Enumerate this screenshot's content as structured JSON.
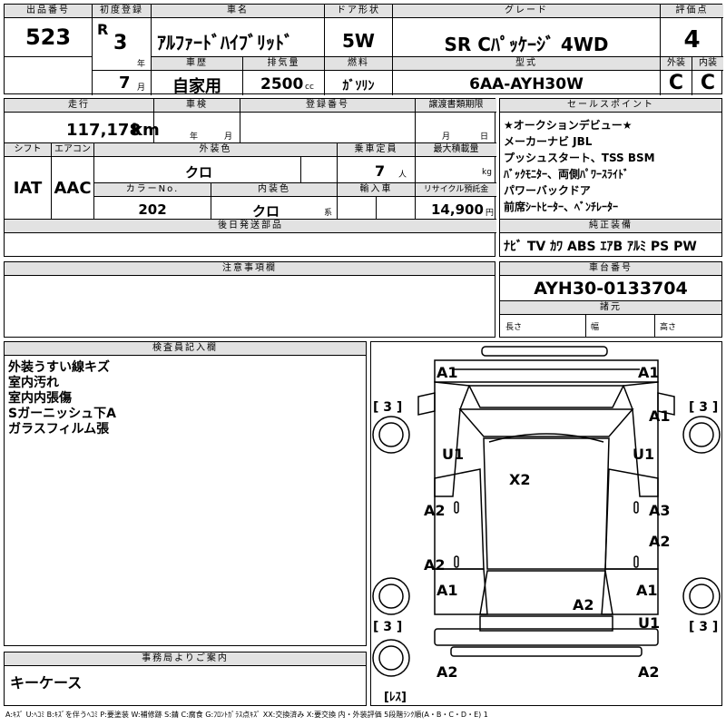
{
  "header": {
    "lot_label": "出品番号",
    "lot": "523",
    "reg_label": "初度登録",
    "era": "R",
    "reg_year": "3",
    "year_unit": "年",
    "reg_month": "7",
    "month_unit": "月",
    "car_name_label": "車名",
    "car_name": "ｱﾙﾌｧｰﾄﾞﾊｲﾌﾞﾘｯﾄﾞ",
    "door_label": "ドア形状",
    "door": "5W",
    "grade_label": "グレード",
    "grade": "SR Cﾊﾟｯｹｰｼﾞ 4WD",
    "score_label": "評価点",
    "score": "4",
    "history_label": "車歴",
    "history": "自家用",
    "disp_label": "排気量",
    "displacement": "2500",
    "disp_unit": "cc",
    "fuel_label": "燃料",
    "fuel": "ｶﾞｿﾘﾝ",
    "model_label": "型式",
    "model": "6AA-AYH30W",
    "ext_label": "外装",
    "ext_grade": "C",
    "int_label": "内装",
    "int_grade": "C"
  },
  "row2": {
    "mileage_label": "走行",
    "mileage": "117,178",
    "mileage_unit": "km",
    "inspection_label": "車検",
    "insp_year": "年",
    "insp_month": "月",
    "regno_label": "登録番号",
    "transfer_label": "譲渡書類期限",
    "tr_month": "月",
    "tr_day": "日",
    "shift_label": "シフト",
    "shift": "IAT",
    "ac_label": "エアコン",
    "ac": "AAC",
    "color_label": "外装色",
    "color": "クロ",
    "capacity_label": "乗車定員",
    "capacity": "7",
    "capacity_unit": "人",
    "load_label": "最大積載量",
    "load_unit": "kg",
    "colorno_label": "カラーNo.",
    "colorno": "202",
    "intcolor_label": "内装色",
    "intcolor": "クロ",
    "intcolor_unit": "系",
    "import_label": "輸入車",
    "recycle_label": "リサイクル預託金",
    "recycle": "14,900",
    "recycle_unit": "円",
    "parts_label": "後日発送部品"
  },
  "selling_points": {
    "label": "セールスポイント",
    "lines": [
      "★オークションデビュー★",
      "メーカーナビ JBL",
      "プッシュスタート、TSS BSM",
      "ﾊﾞｯｸﾓﾆﾀｰ、両側ﾊﾟﾜｰｽﾗｲﾄﾞ",
      "パワーバックドア",
      "前席ｼｰﾄﾋｰﾀｰ、ﾍﾞﾝﾁﾚｰﾀｰ"
    ]
  },
  "equipment": {
    "label": "純正装備",
    "items": "ﾅﾋﾞ TV ｶﾜ ABS ｴｱB ｱﾙﾐ PS PW"
  },
  "notes": {
    "label": "注意事項欄"
  },
  "chassis": {
    "label": "車台番号",
    "number": "AYH30-0133704",
    "dims_label": "諸元",
    "length": "長さ",
    "width": "幅",
    "height": "高さ"
  },
  "inspector": {
    "label": "検査員記入欄",
    "lines": [
      "外装うすい線キズ",
      "室内汚れ",
      "室内内張傷",
      "Sガーニッシュ下A",
      "ガラスフィルム張"
    ]
  },
  "office": {
    "label": "事務局よりご案内",
    "text": "キーケース"
  },
  "diagram": {
    "tire_marks": [
      "[ 3 ]",
      "[ 3 ]",
      "[ 3 ]",
      "[ 3 ]"
    ],
    "spare_mark": "[ﾚｽ]",
    "marks": [
      "A1",
      "A1",
      "A1",
      "U1",
      "U1",
      "X2",
      "A2",
      "A3",
      "A2",
      "A2",
      "A1",
      "A1",
      "A2",
      "U1",
      "A2",
      "A2"
    ]
  },
  "legend": "A:ｷｽﾞ U:ﾍｺﾐ B:ｷｽﾞを伴うﾍｺﾐ P:要塗装 W:補修跡 S:錆 C:腐食 G:ﾌﾛﾝﾄｶﾞﾗｽ点ｷｽﾞ XX:交換済み X:要交換 内・外装評価 5段階ﾗﾝｸ順(A・B・C・D・E) 1"
}
